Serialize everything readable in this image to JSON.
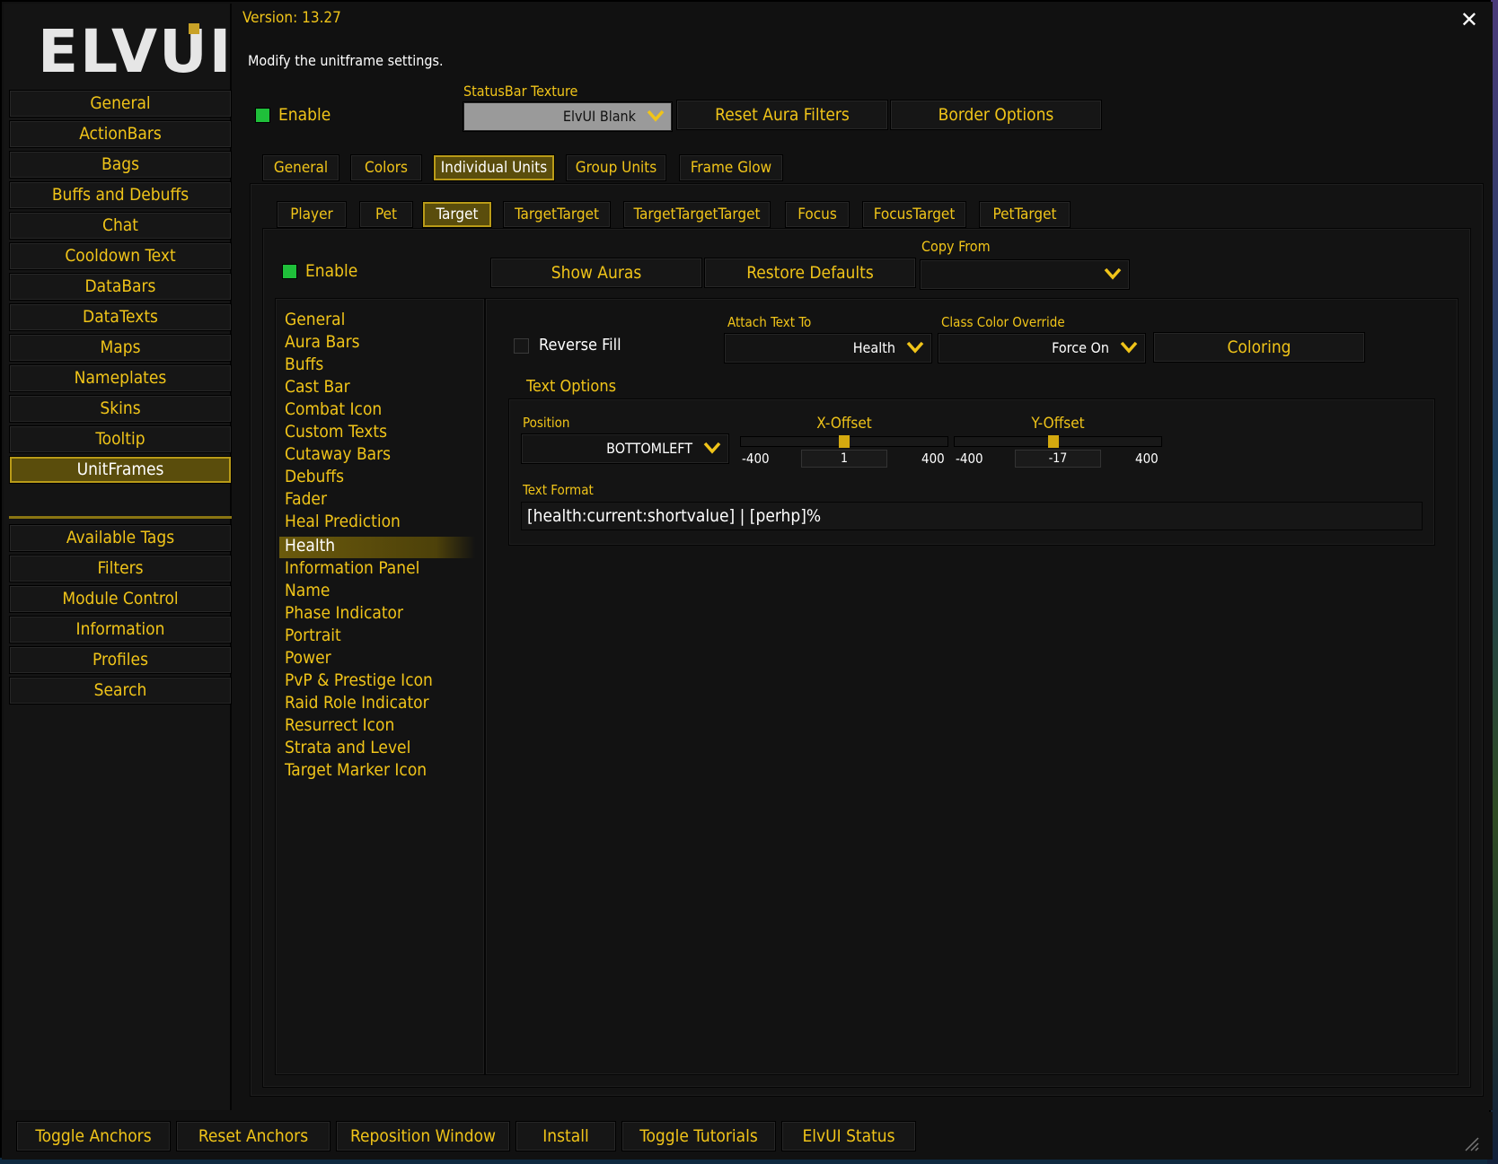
{
  "logo": "ELVUI",
  "version": "Version: 13.27",
  "description": "Modify the unitframe settings.",
  "colors": {
    "accent": "#f0c419",
    "active_bg": "#5a4d0c",
    "enable_green": "#1fbf3a",
    "panel": "#131313"
  },
  "sidebar": {
    "items": [
      {
        "label": "General"
      },
      {
        "label": "ActionBars"
      },
      {
        "label": "Bags"
      },
      {
        "label": "Buffs and Debuffs"
      },
      {
        "label": "Chat"
      },
      {
        "label": "Cooldown Text"
      },
      {
        "label": "DataBars"
      },
      {
        "label": "DataTexts"
      },
      {
        "label": "Maps"
      },
      {
        "label": "Nameplates"
      },
      {
        "label": "Skins"
      },
      {
        "label": "Tooltip"
      },
      {
        "label": "UnitFrames"
      }
    ],
    "items2": [
      {
        "label": "Available Tags"
      },
      {
        "label": "Filters"
      },
      {
        "label": "Module Control"
      },
      {
        "label": "Information"
      },
      {
        "label": "Profiles"
      },
      {
        "label": "Search"
      }
    ]
  },
  "top": {
    "enable_label": "Enable",
    "statusbar_label": "StatusBar Texture",
    "statusbar_value": "ElvUI Blank",
    "reset_aura_filters": "Reset Aura Filters",
    "border_options": "Border Options"
  },
  "main_tabs": [
    {
      "label": "General"
    },
    {
      "label": "Colors"
    },
    {
      "label": "Individual Units"
    },
    {
      "label": "Group Units"
    },
    {
      "label": "Frame Glow"
    }
  ],
  "unit_tabs": [
    {
      "label": "Player"
    },
    {
      "label": "Pet"
    },
    {
      "label": "Target"
    },
    {
      "label": "TargetTarget"
    },
    {
      "label": "TargetTargetTarget"
    },
    {
      "label": "Focus"
    },
    {
      "label": "FocusTarget"
    },
    {
      "label": "PetTarget"
    }
  ],
  "unit": {
    "enable_label": "Enable",
    "show_auras": "Show Auras",
    "restore_defaults": "Restore Defaults",
    "copy_from_label": "Copy From",
    "copy_from_value": ""
  },
  "sub_items": [
    "General",
    "Aura Bars",
    "Buffs",
    "Cast Bar",
    "Combat Icon",
    "Custom Texts",
    "Cutaway Bars",
    "Debuffs",
    "Fader",
    "Heal Prediction",
    "Health",
    "Information Panel",
    "Name",
    "Phase Indicator",
    "Portrait",
    "Power",
    "PvP & Prestige Icon",
    "Raid Role Indicator",
    "Resurrect Icon",
    "Strata and Level",
    "Target Marker Icon"
  ],
  "health": {
    "reverse_fill": "Reverse Fill",
    "attach_label": "Attach Text To",
    "attach_value": "Health",
    "class_color_label": "Class Color Override",
    "class_color_value": "Force On",
    "coloring": "Coloring",
    "text_options": "Text Options",
    "position_label": "Position",
    "position_value": "BOTTOMLEFT",
    "xoffset_label": "X-Offset",
    "xoffset_value": "1",
    "xoffset_min": "-400",
    "xoffset_max": "400",
    "xoffset_fraction": 0.501,
    "yoffset_label": "Y-Offset",
    "yoffset_value": "-17",
    "yoffset_min": "-400",
    "yoffset_max": "400",
    "yoffset_fraction": 0.479,
    "text_format_label": "Text Format",
    "text_format_value": "[health:current:shortvalue] | [perhp]%"
  },
  "bottom": [
    {
      "label": "Toggle Anchors"
    },
    {
      "label": "Reset Anchors"
    },
    {
      "label": "Reposition Window"
    },
    {
      "label": "Install"
    },
    {
      "label": "Toggle Tutorials"
    },
    {
      "label": "ElvUI Status"
    }
  ]
}
